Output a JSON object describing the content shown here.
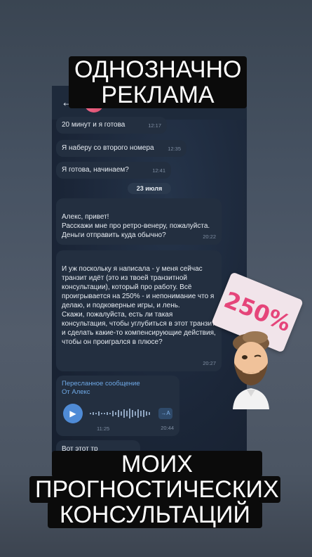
{
  "overlay": {
    "top_caption_line1": "ОДНОЗНАЧНО",
    "top_caption_line2": "РЕКЛАМА",
    "bottom_caption_line1": "МОИХ",
    "bottom_caption_line2": "ПРОГНОСТИЧЕСКИХ",
    "bottom_caption_line3": "КОНСУЛЬТАЦИЙ",
    "sticker_label": "250%"
  },
  "chat": {
    "header": {
      "contact_name": ""
    },
    "messages": [
      {
        "text": "20 минут и я готова",
        "time": "12:17"
      },
      {
        "text": "Я наберу со второго номера",
        "time": "12:35"
      },
      {
        "text": "Я готова, начинаем?",
        "time": "12:41"
      }
    ],
    "date_divider": "23 июля",
    "long_messages": [
      {
        "text": "Алекс, привет!\nРасскажи мне про ретро-венеру, пожалуйста.\nДеньги отправить куда обычно?",
        "time": "20:22"
      },
      {
        "text": "И уж поскольку я написала - у меня сейчас транзит идёт (это из твоей транзитной консультации), который про работу. Всё проигрывается на 250% - и непонимание что я делаю, и подковерные игры, и лень.\nСкажи, пожалуйста, есть ли такая консультация, чтобы углубиться в этот транзит и сделать какие-то компенсирующие действия, чтобы он проигрался в плюсе?",
        "time": "20:27"
      }
    ],
    "forwarded": {
      "title": "Пересланное сообщение",
      "from": "От Алекс",
      "voice_duration": "11:25",
      "transcribe_label": "→A",
      "time": "20:44"
    },
    "last_message": {
      "text": "Вот этот тр"
    }
  },
  "icons": {
    "back": "arrow-left-icon",
    "more": "more-vertical-icon",
    "play": "play-icon",
    "transcribe": "speech-to-text-icon"
  },
  "colors": {
    "accent": "#4f8bd6",
    "link": "#6fa9e6",
    "bubble": "#232f40",
    "sticker_text": "#e5457a"
  }
}
